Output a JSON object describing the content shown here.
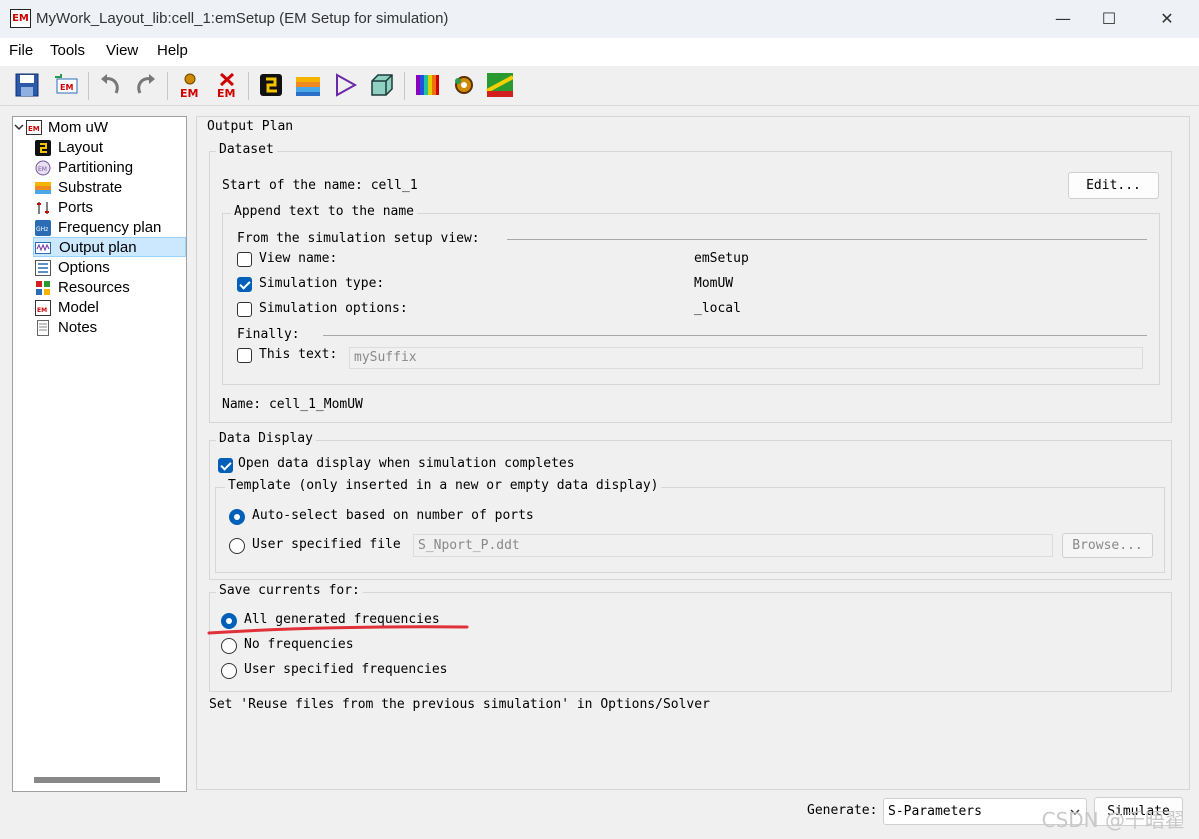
{
  "window": {
    "app_icon_text": "EM",
    "title": "MyWork_Layout_lib:cell_1:emSetup (EM Setup for simulation)",
    "controls": {
      "minimize": "—",
      "maximize": "☐",
      "close": "✕"
    }
  },
  "menu": [
    "File",
    "Tools",
    "View",
    "Help"
  ],
  "toolbar": {
    "icons": [
      "save-icon",
      "em-import-icon",
      "undo-icon",
      "redo-icon",
      "em-simulate-icon",
      "em-stop-icon",
      "layout-icon",
      "substrate-icon",
      "port-icon",
      "box-3d-icon",
      "spectrum-icon",
      "settings-icon",
      "mesh-icon"
    ],
    "em_label": "EM"
  },
  "tree": {
    "root": {
      "label": "Mom uW",
      "expanded": true
    },
    "items": [
      {
        "label": "Layout",
        "icon": "layout-icon"
      },
      {
        "label": "Partitioning",
        "icon": "partitioning-icon"
      },
      {
        "label": "Substrate",
        "icon": "substrate-icon"
      },
      {
        "label": "Ports",
        "icon": "ports-icon"
      },
      {
        "label": "Frequency plan",
        "icon": "frequency-icon"
      },
      {
        "label": "Output plan",
        "icon": "output-icon",
        "selected": true
      },
      {
        "label": "Options",
        "icon": "options-icon"
      },
      {
        "label": "Resources",
        "icon": "resources-icon"
      },
      {
        "label": "Model",
        "icon": "model-icon"
      },
      {
        "label": "Notes",
        "icon": "notes-icon"
      }
    ]
  },
  "output_plan": {
    "title": "Output Plan",
    "dataset": {
      "title": "Dataset",
      "start_label": "Start of the name: cell_1",
      "edit_button": "Edit...",
      "append": {
        "title": "Append text to the name",
        "from_label": "From the simulation setup view:",
        "view_name": {
          "label": "View name:",
          "value": "emSetup",
          "checked": false
        },
        "sim_type": {
          "label": "Simulation type:",
          "value": "MomUW",
          "checked": true
        },
        "sim_options": {
          "label": "Simulation options:",
          "value": "_local",
          "checked": false
        },
        "finally_label": "Finally:",
        "this_text": {
          "label": "This text:",
          "placeholder": "mySuffix",
          "checked": false
        }
      },
      "name_label": "Name: cell_1_MomUW"
    },
    "data_display": {
      "title": "Data Display",
      "open_label": "Open data display when simulation completes",
      "open_checked": true,
      "template": {
        "title": "Template (only inserted in a new or empty data display)",
        "auto_label": "Auto-select based on number of ports",
        "user_label": "User specified file",
        "file_value": "S_Nport_P.ddt",
        "browse_button": "Browse...",
        "selected": "auto"
      }
    },
    "save_currents": {
      "title": "Save currents for:",
      "options": [
        {
          "label": "All generated frequencies",
          "selected": true
        },
        {
          "label": "No frequencies",
          "selected": false
        },
        {
          "label": "User specified frequencies",
          "selected": false
        }
      ]
    },
    "note": "Set 'Reuse files from the previous simulation' in Options/Solver"
  },
  "footer": {
    "generate_label": "Generate:",
    "generate_value": "S-Parameters",
    "simulate_button": "Simulate"
  },
  "watermark": "CSDN @千晤翟",
  "colors": {
    "accent": "#005fb8",
    "annotation": "#e0303a",
    "selection": "#cce8ff"
  }
}
